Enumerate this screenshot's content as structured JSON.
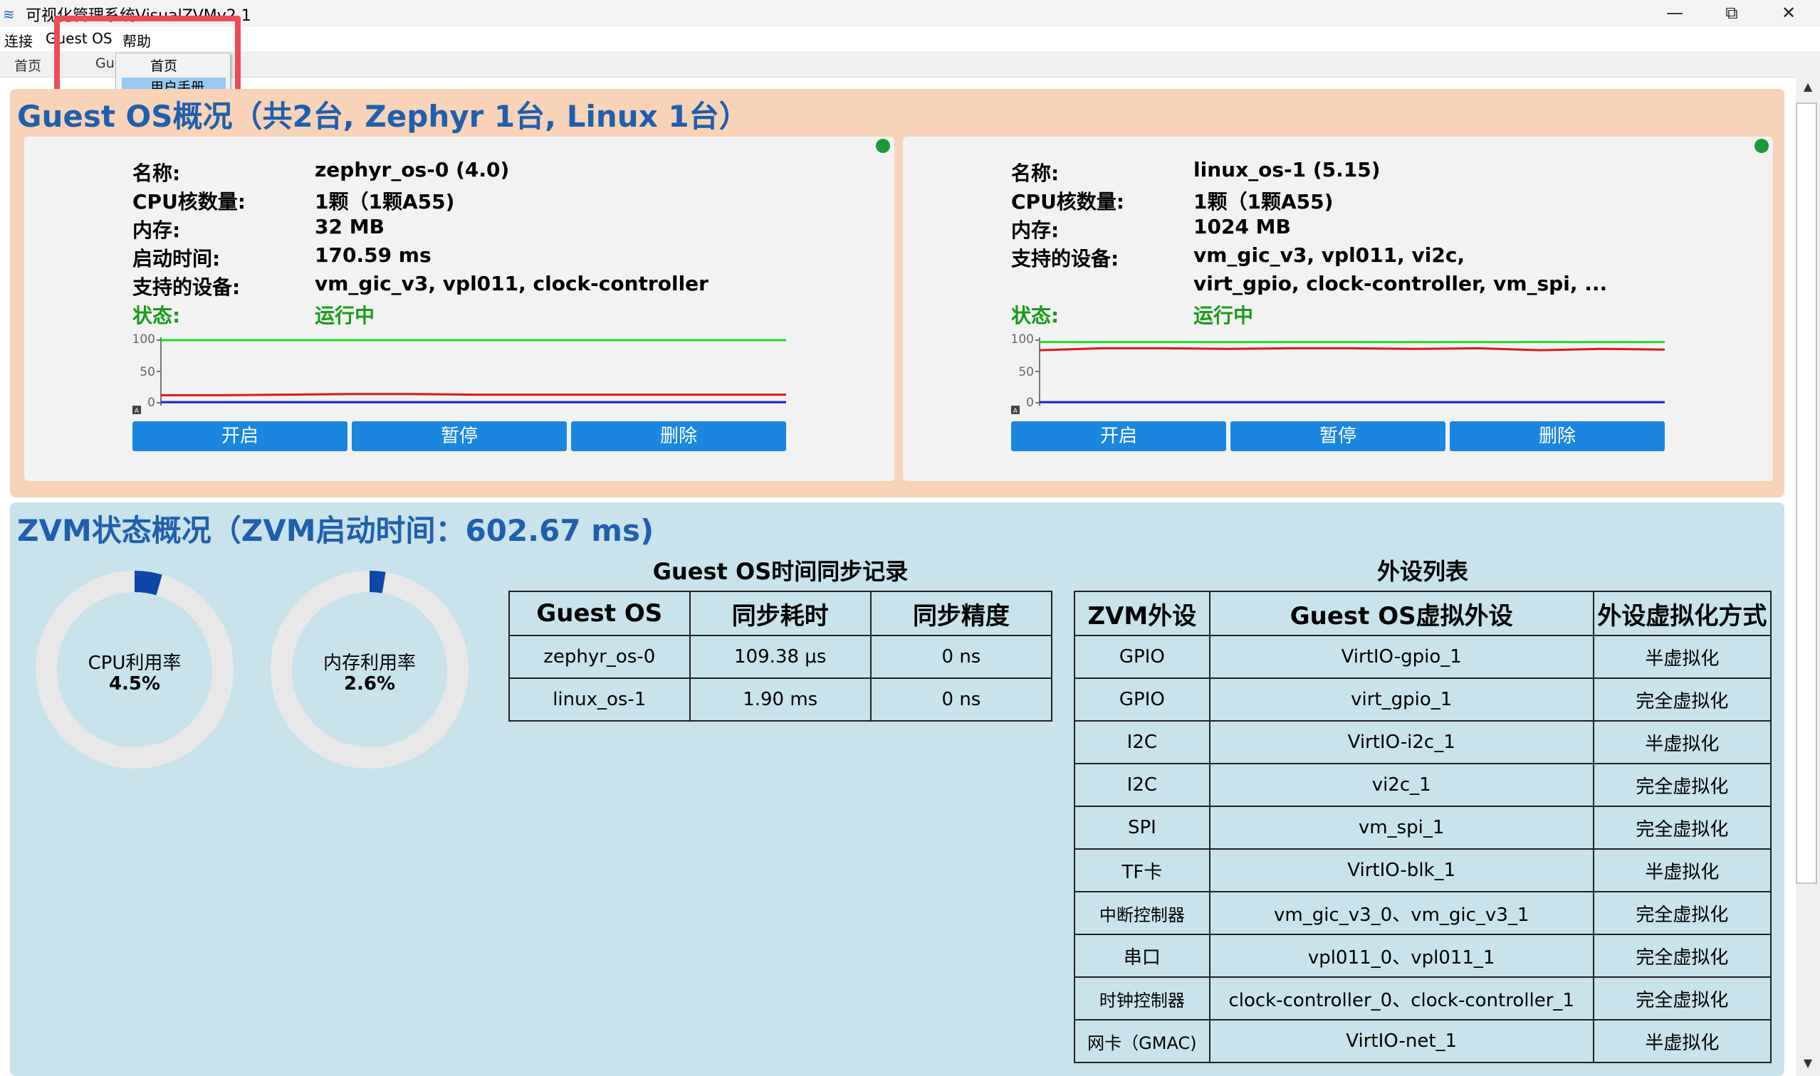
{
  "window": {
    "title": "可视化管理系统VisualZVMv2.1",
    "minimize": "—",
    "maximize": "⧉",
    "close": "✕"
  },
  "menu": [
    {
      "label": "连接"
    },
    {
      "label": "Guest OS"
    },
    {
      "label": "帮助"
    }
  ],
  "tabs": [
    {
      "label": "首页"
    },
    {
      "label": "Gue"
    }
  ],
  "dropdown": {
    "items": [
      {
        "label": "首页"
      },
      {
        "label": "用户手册"
      }
    ],
    "selected": "用户手册"
  },
  "guest_section": {
    "title": "Guest OS概况（共2台, Zephyr 1台, Linux 1台）",
    "cards": [
      {
        "rows": [
          {
            "label": "名称:",
            "value": "zephyr_os-0 (4.0)"
          },
          {
            "label": "CPU核数量:",
            "value": "1颗（1颗A55)"
          },
          {
            "label": "内存:",
            "value": "32 MB"
          },
          {
            "label": "启动时间:",
            "value": "170.59 ms"
          },
          {
            "label": "支持的设备:",
            "value": "vm_gic_v3, vpl011, clock-controller"
          }
        ],
        "status_label": "状态:",
        "status_value": "运行中",
        "chart_ticks": [
          "100",
          "50",
          "0"
        ],
        "chart_corner": "A",
        "buttons": {
          "start": "开启",
          "pause": "暂停",
          "delete": "删除"
        }
      },
      {
        "rows": [
          {
            "label": "名称:",
            "value": "linux_os-1 (5.15)"
          },
          {
            "label": "CPU核数量:",
            "value": "1颗（1颗A55)"
          },
          {
            "label": "内存:",
            "value": "1024 MB"
          },
          {
            "label": "支持的设备:",
            "value": "vm_gic_v3, vpl011, vi2c,",
            "value2": "virt_gpio, clock-controller, vm_spi, ..."
          }
        ],
        "status_label": "状态:",
        "status_value": "运行中",
        "chart_ticks": [
          "100",
          "50",
          "0"
        ],
        "chart_corner": "A",
        "buttons": {
          "start": "开启",
          "pause": "暂停",
          "delete": "删除"
        }
      }
    ]
  },
  "chart_data": [
    {
      "type": "line",
      "y_range": [
        0,
        100
      ],
      "y_ticks": [
        0,
        50,
        100
      ],
      "grid": false,
      "series": [
        {
          "color": "#22dd22",
          "values": [
            100,
            100,
            100,
            100,
            100,
            100,
            100,
            100,
            100,
            100,
            100
          ]
        },
        {
          "color": "#e01818",
          "values": [
            12,
            12,
            13,
            14,
            14,
            13,
            13,
            13,
            13,
            13,
            13
          ]
        },
        {
          "color": "#1a1ae0",
          "values": [
            1,
            1,
            1,
            1,
            1,
            1,
            1,
            1,
            1,
            1,
            1
          ]
        }
      ]
    },
    {
      "type": "line",
      "y_range": [
        0,
        100
      ],
      "y_ticks": [
        0,
        50,
        100
      ],
      "grid": false,
      "series": [
        {
          "color": "#22dd22",
          "values": [
            97,
            97,
            97,
            97,
            97,
            97,
            97,
            97,
            97,
            97,
            97
          ]
        },
        {
          "color": "#e01818",
          "values": [
            84,
            87,
            87,
            86,
            87,
            87,
            86,
            87,
            84,
            86,
            85
          ]
        },
        {
          "color": "#1a1ae0",
          "values": [
            1,
            1,
            1,
            1,
            1,
            1,
            1,
            1,
            1,
            1,
            1
          ]
        }
      ]
    }
  ],
  "zvm_section": {
    "title": "ZVM状态概况（ZVM启动时间：602.67 ms)",
    "cpu": {
      "label": "CPU利用率",
      "value": "4.5%",
      "percent": 4.5
    },
    "mem": {
      "label": "内存利用率",
      "value": "2.6%",
      "percent": 2.6
    },
    "donut_colors": {
      "track": "#e8e8e8",
      "fill": "#0d47a8"
    }
  },
  "sync_table": {
    "title": "Guest OS时间同步记录",
    "headers": [
      "Guest OS",
      "同步耗时",
      "同步精度"
    ],
    "rows": [
      [
        "zephyr_os-0",
        "109.38 μs",
        "0 ns"
      ],
      [
        "linux_os-1",
        "1.90 ms",
        "0 ns"
      ]
    ]
  },
  "device_table": {
    "title": "外设列表",
    "headers": [
      "ZVM外设",
      "Guest OS虚拟外设",
      "外设虚拟化方式"
    ],
    "rows": [
      [
        "GPIO",
        "VirtIO-gpio_1",
        "半虚拟化"
      ],
      [
        "GPIO",
        "virt_gpio_1",
        "完全虚拟化"
      ],
      [
        "I2C",
        "VirtIO-i2c_1",
        "半虚拟化"
      ],
      [
        "I2C",
        "vi2c_1",
        "完全虚拟化"
      ],
      [
        "SPI",
        "vm_spi_1",
        "完全虚拟化"
      ],
      [
        "TF卡",
        "VirtIO-blk_1",
        "半虚拟化"
      ],
      [
        "中断控制器",
        "vm_gic_v3_0、vm_gic_v3_1",
        "完全虚拟化"
      ],
      [
        "串口",
        "vpl011_0、vpl011_1",
        "完全虚拟化"
      ],
      [
        "时钟控制器",
        "clock-controller_0、clock-controller_1",
        "完全虚拟化"
      ],
      [
        "网卡（GMAC)",
        "VirtIO-net_1",
        "半虚拟化"
      ]
    ]
  }
}
